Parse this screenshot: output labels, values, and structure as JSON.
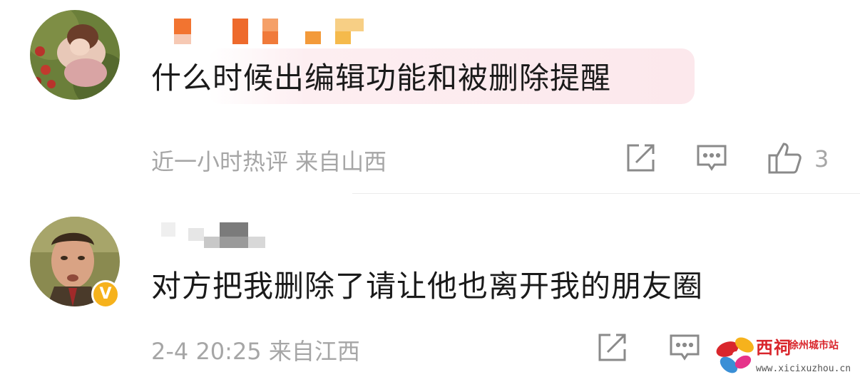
{
  "comments": [
    {
      "text": "什么时候出编辑功能和被删除提醒",
      "meta": "近一小时热评 来自山西",
      "likes": "3"
    },
    {
      "text": "对方把我删除了请让他也离开我的朋友圈",
      "meta": "2-4 20:25 来自江西",
      "badge": "V"
    }
  ],
  "icons": [
    "share-icon",
    "reply-icon",
    "like-icon"
  ],
  "watermark": {
    "title": "西祠",
    "subtitle": "徐州城市站",
    "url": "www.xicixuzhou.cn"
  },
  "colors": {
    "meta_text": "#a6a6a6",
    "highlight": "#fce8ec",
    "badge": "#f6b21c",
    "watermark_red": "#d9262c"
  }
}
